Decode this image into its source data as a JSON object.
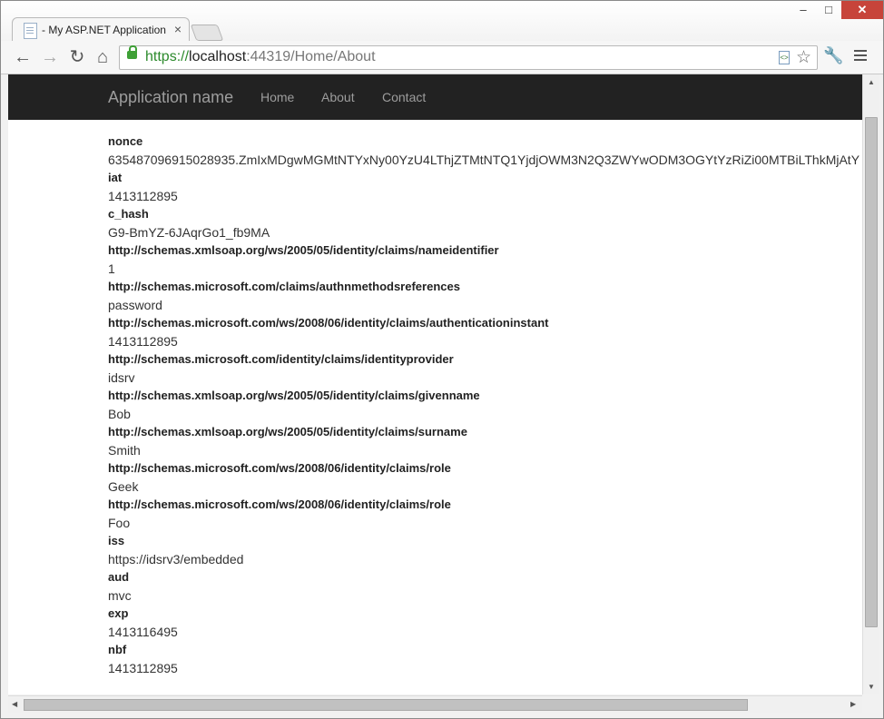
{
  "browser": {
    "tab_title": "- My ASP.NET Application",
    "tab_close": "×",
    "window_controls": {
      "minimize": "–",
      "maximize": "□",
      "close": "✕"
    },
    "nav": {
      "back": "←",
      "forward": "→",
      "reload": "↻",
      "home": "⌂"
    },
    "url": {
      "scheme": "https://",
      "host": "localhost",
      "rest": ":44319/Home/About"
    },
    "icons": [
      "back-arrow-icon",
      "forward-arrow-icon",
      "reload-icon",
      "home-icon",
      "lock-icon",
      "page-icon",
      "star-icon",
      "wrench-icon",
      "menu-icon"
    ]
  },
  "site": {
    "brand": "Application name",
    "nav": [
      "Home",
      "About",
      "Contact"
    ],
    "navbar_color": "#222222"
  },
  "claims": [
    {
      "key": "nonce",
      "value": "635487096915028935.ZmIxMDgwMGMtNTYxNy00YzU4LThjZTMtNTQ1YjdjOWM3N2Q3ZWYwODM3OGYtYzRiZi00MTBiLThkMjAtY"
    },
    {
      "key": "iat",
      "value": "1413112895"
    },
    {
      "key": "c_hash",
      "value": "G9-BmYZ-6JAqrGo1_fb9MA"
    },
    {
      "key": "http://schemas.xmlsoap.org/ws/2005/05/identity/claims/nameidentifier",
      "value": "1"
    },
    {
      "key": "http://schemas.microsoft.com/claims/authnmethodsreferences",
      "value": "password"
    },
    {
      "key": "http://schemas.microsoft.com/ws/2008/06/identity/claims/authenticationinstant",
      "value": "1413112895"
    },
    {
      "key": "http://schemas.microsoft.com/identity/claims/identityprovider",
      "value": "idsrv"
    },
    {
      "key": "http://schemas.xmlsoap.org/ws/2005/05/identity/claims/givenname",
      "value": "Bob"
    },
    {
      "key": "http://schemas.xmlsoap.org/ws/2005/05/identity/claims/surname",
      "value": "Smith"
    },
    {
      "key": "http://schemas.microsoft.com/ws/2008/06/identity/claims/role",
      "value": "Geek"
    },
    {
      "key": "http://schemas.microsoft.com/ws/2008/06/identity/claims/role",
      "value": "Foo"
    },
    {
      "key": "iss",
      "value": "https://idsrv3/embedded"
    },
    {
      "key": "aud",
      "value": "mvc"
    },
    {
      "key": "exp",
      "value": "1413116495"
    },
    {
      "key": "nbf",
      "value": "1413112895"
    }
  ]
}
